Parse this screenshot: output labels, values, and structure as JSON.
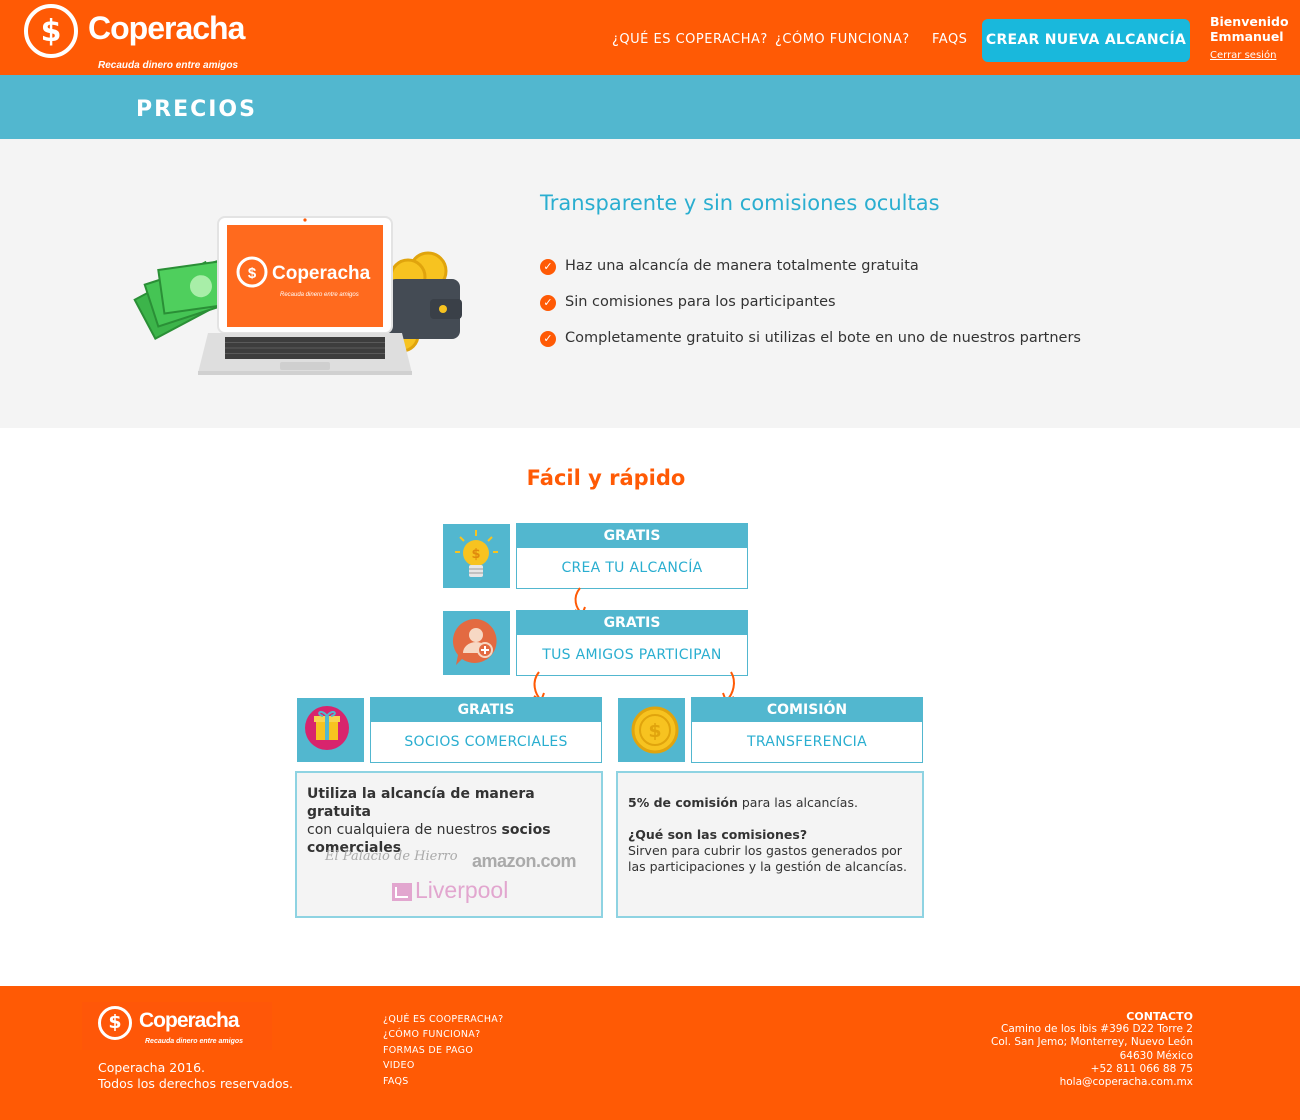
{
  "header": {
    "logo_name": "Coperacha",
    "logo_tagline": "Recauda dinero entre amigos",
    "nav": [
      "¿QUÉ ES COPERACHA?",
      "¿CÓMO FUNCIONA?",
      "FAQS"
    ],
    "cta": "CREAR NUEVA ALCANCÍA",
    "welcome_line1": "Bienvenido",
    "welcome_line2": "Emmanuel",
    "logout": "Cerrar sesión"
  },
  "band": {
    "title": "PRECIOS"
  },
  "hero": {
    "title": "Transparente y sin comisiones ocultas",
    "laptop_logo": "Coperacha",
    "laptop_tagline": "Recauda dinero entre amigos",
    "features": [
      "Haz una alcancía de manera totalmente gratuita",
      "Sin comisiones para los participantes",
      "Completamente gratuito si utilizas el bote en uno de nuestros partners"
    ]
  },
  "flow": {
    "title": "Fácil y rápido",
    "steps": [
      {
        "header": "GRATIS",
        "body": "CREA TU ALCANCÍA"
      },
      {
        "header": "GRATIS",
        "body": "TUS AMIGOS PARTICIPAN"
      },
      {
        "header": "GRATIS",
        "body": "SOCIOS COMERCIALES"
      },
      {
        "header": "COMISIÓN",
        "body": "TRANSFERENCIA"
      }
    ],
    "partners_card": {
      "bold1": "Utiliza la alcancía de manera gratuita",
      "text": "con cualquiera de  nuestros",
      "bold2": "socios comerciales",
      "brands": [
        "El Palacio de Hierro",
        "amazon.com",
        "Liverpool"
      ]
    },
    "commission_card": {
      "bold1": "5% de comisión",
      "text1": "para las alcancías.",
      "question": "¿Qué son las comisiones?",
      "answer": "Sirven para cubrir los gastos generados por las participaciones y la gestión de alcancías."
    }
  },
  "footer": {
    "logo_name": "Coperacha",
    "logo_tagline": "Recauda dinero entre amigos",
    "copyright_line1": "Coperacha 2016.",
    "copyright_line2": "Todos los derechos reservados.",
    "links": [
      "¿QUÉ ES COOPERACHA?",
      "¿CÓMO FUNCIONA?",
      "FORMAS DE PAGO",
      "VIDEO",
      "FAQS"
    ],
    "contact_title": "CONTACTO",
    "contact_lines": [
      "Camino de los ibis #396 D22 Torre 2",
      "Col. San Jemo; Monterrey, Nuevo León",
      "64630 México",
      "+52 811 066 88 75",
      "hola@coperacha.com.mx"
    ]
  },
  "colors": {
    "brand": "#ff5a05",
    "accent": "#52b7cf",
    "cta": "#19b8dc"
  }
}
